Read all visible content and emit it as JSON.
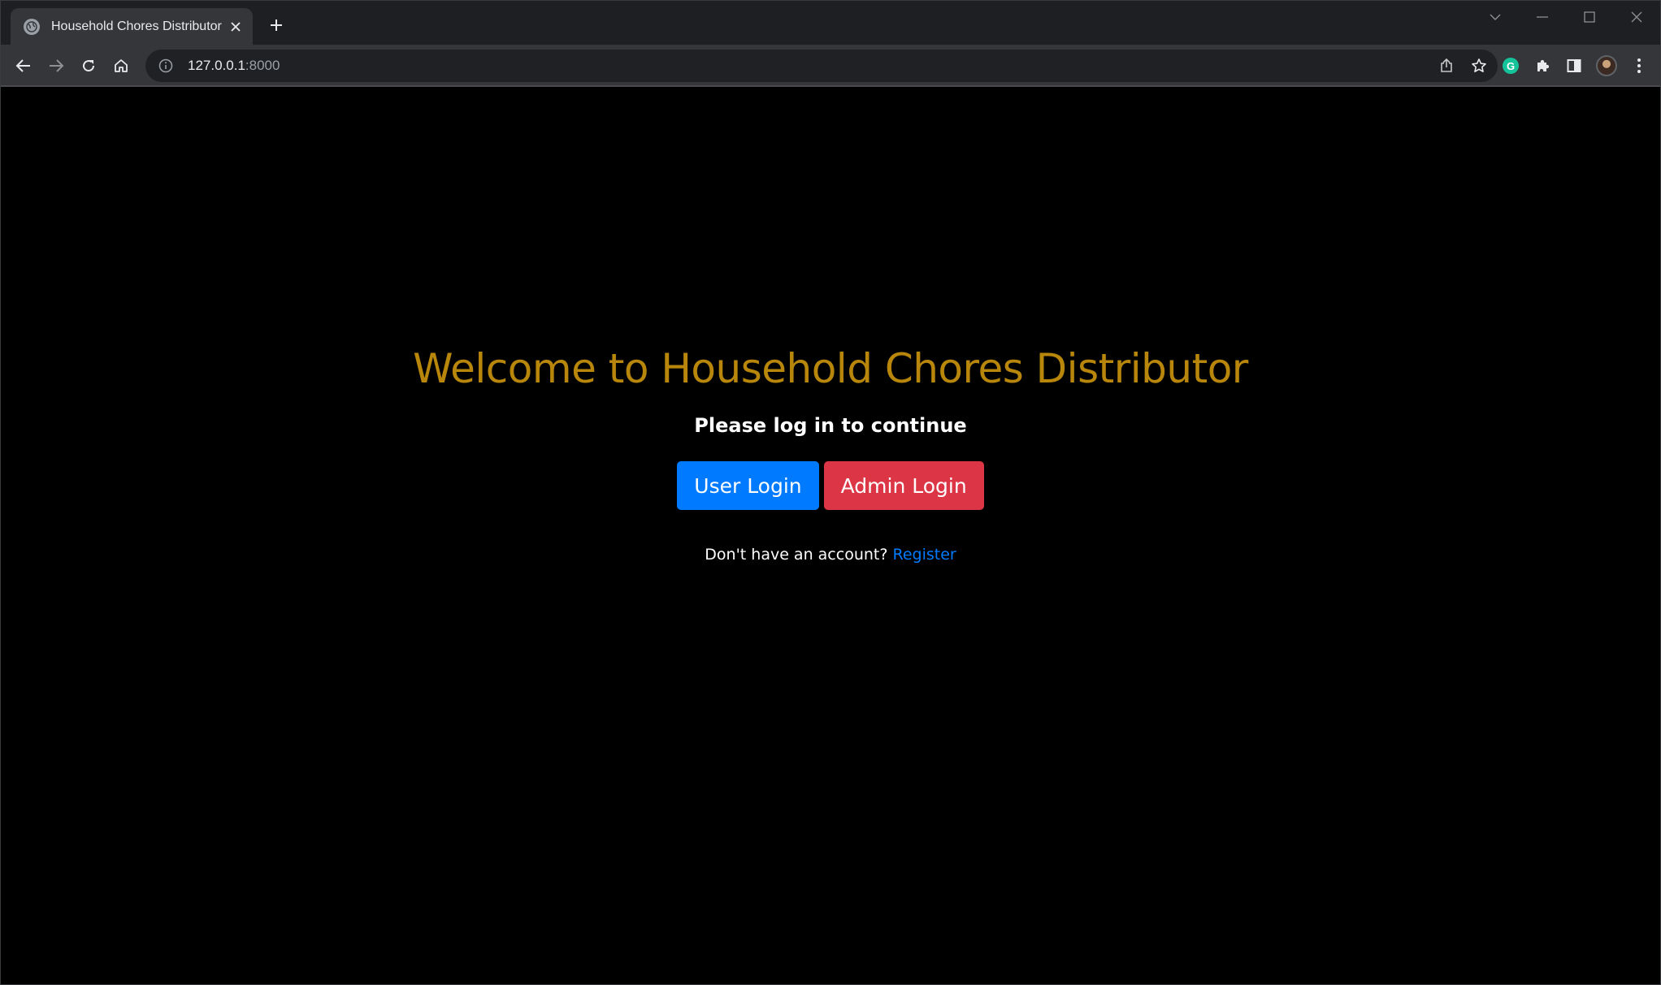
{
  "browser": {
    "tab": {
      "title": "Household Chores Distributor",
      "favicon": "globe-icon"
    },
    "address_bar": {
      "host": "127.0.0.1",
      "port": ":8000"
    },
    "icons": {
      "back": "arrow-left-icon",
      "forward": "arrow-right-icon",
      "reload": "reload-icon",
      "home": "home-icon",
      "site_info": "info-icon",
      "share": "share-icon",
      "bookmark": "star-icon",
      "grammarly": "grammarly-icon",
      "extensions": "puzzle-icon",
      "side_panel": "side-panel-icon",
      "profile": "avatar",
      "menu": "kebab-menu-icon"
    },
    "grammarly_letter": "G"
  },
  "page": {
    "heading": "Welcome to Household Chores Distributor",
    "subheading": "Please log in to continue",
    "buttons": {
      "user_login": "User Login",
      "admin_login": "Admin Login"
    },
    "register": {
      "prompt": "Don't have an account?",
      "link": "Register"
    }
  },
  "colors": {
    "page_background": "#000000",
    "heading": "#b8860b",
    "user_login_button": "#007bff",
    "admin_login_button": "#dc3545",
    "link": "#007bff"
  }
}
